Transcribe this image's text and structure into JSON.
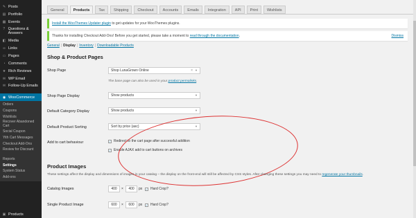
{
  "sidebar": {
    "items": [
      {
        "label": "Posts",
        "icon": "pin-icon"
      },
      {
        "label": "Portfolio",
        "icon": "portfolio-icon"
      },
      {
        "label": "Events",
        "icon": "calendar-icon"
      },
      {
        "label": "Questions & Answers",
        "icon": "question-icon"
      },
      {
        "label": "Media",
        "icon": "media-icon"
      },
      {
        "label": "Links",
        "icon": "link-icon"
      },
      {
        "label": "Pages",
        "icon": "page-icon"
      },
      {
        "label": "Comments",
        "icon": "comment-icon"
      },
      {
        "label": "Rich Reviews",
        "icon": "star-icon"
      },
      {
        "label": "WP Email",
        "icon": "email-icon"
      },
      {
        "label": "Follow-Up Emails",
        "icon": "email-icon"
      }
    ],
    "active": {
      "label": "WooCommerce",
      "icon": "woocommerce-icon"
    },
    "submenu": [
      "Orders",
      "Coupons",
      "Wishlists",
      "Recover Abandoned Cart",
      "Social Coupon",
      "Yith Cart Messages",
      "Checkout Add-Ons",
      "Review for Discount",
      "Reports",
      "Settings",
      "System Status",
      "Add-ons"
    ],
    "submenu_current": "Settings",
    "bottom": {
      "label": "Products",
      "icon": "products-icon"
    }
  },
  "tabs": [
    "General",
    "Products",
    "Tax",
    "Shipping",
    "Checkout",
    "Accounts",
    "Emails",
    "Integration",
    "API",
    "Print",
    "Wishlists"
  ],
  "active_tab": "Products",
  "notice1": {
    "before": "",
    "link": "Install the WooThemes Updater plugin",
    "after": " to get updates for your WooThemes plugins."
  },
  "notice2": {
    "before": "Thanks for installing Checkout Add-Ons! Before you get started, please take a moment to ",
    "link": "read through the documentation",
    "after": ".",
    "dismiss": "Dismiss"
  },
  "subsubsub": {
    "general": "General",
    "display": "Display",
    "inventory": "Inventory",
    "downloadable": "Downloadable Products",
    "sep": "|"
  },
  "section1": {
    "heading": "Shop & Product Pages",
    "shop_page_label": "Shop Page",
    "shop_page_value": "Shop LunaGrown Online",
    "shop_page_clear": "×",
    "shop_page_desc": "The base page can also be used in your ",
    "shop_page_desc_link": "product permalinks",
    "shop_page_desc_end": ".",
    "shop_display_label": "Shop Page Display",
    "shop_display_value": "Show products",
    "category_display_label": "Default Category Display",
    "category_display_value": "Show products",
    "sorting_label": "Default Product Sorting",
    "sorting_value": "Sort by price (asc)",
    "cart_label": "Add to cart behaviour",
    "cart_opt1": "Redirect to the cart page after successful addition",
    "cart_opt2": "Enable AJAX add to cart buttons on archives",
    "check_mark": "✓",
    "arrow": "▼"
  },
  "section2": {
    "heading": "Product Images",
    "para": "These settings affect the display and dimensions of images in your catalog – the display on the front-end will still be affected by CSS styles. After changing these settings you may need to ",
    "para_link": "regenerate your thumbnails",
    "para_end": ".",
    "catalog_label": "Catalog Images",
    "catalog_w": "400",
    "catalog_h": "400",
    "single_label": "Single Product Image",
    "single_w": "600",
    "single_h": "600",
    "times": "×",
    "px": "px",
    "hard_crop": "Hard Crop?"
  },
  "colors": {
    "accent": "#0074a2",
    "sidebar": "#222222",
    "active": "#0074a2",
    "annotation": "#dd3333",
    "notice": "#7ad03a"
  }
}
